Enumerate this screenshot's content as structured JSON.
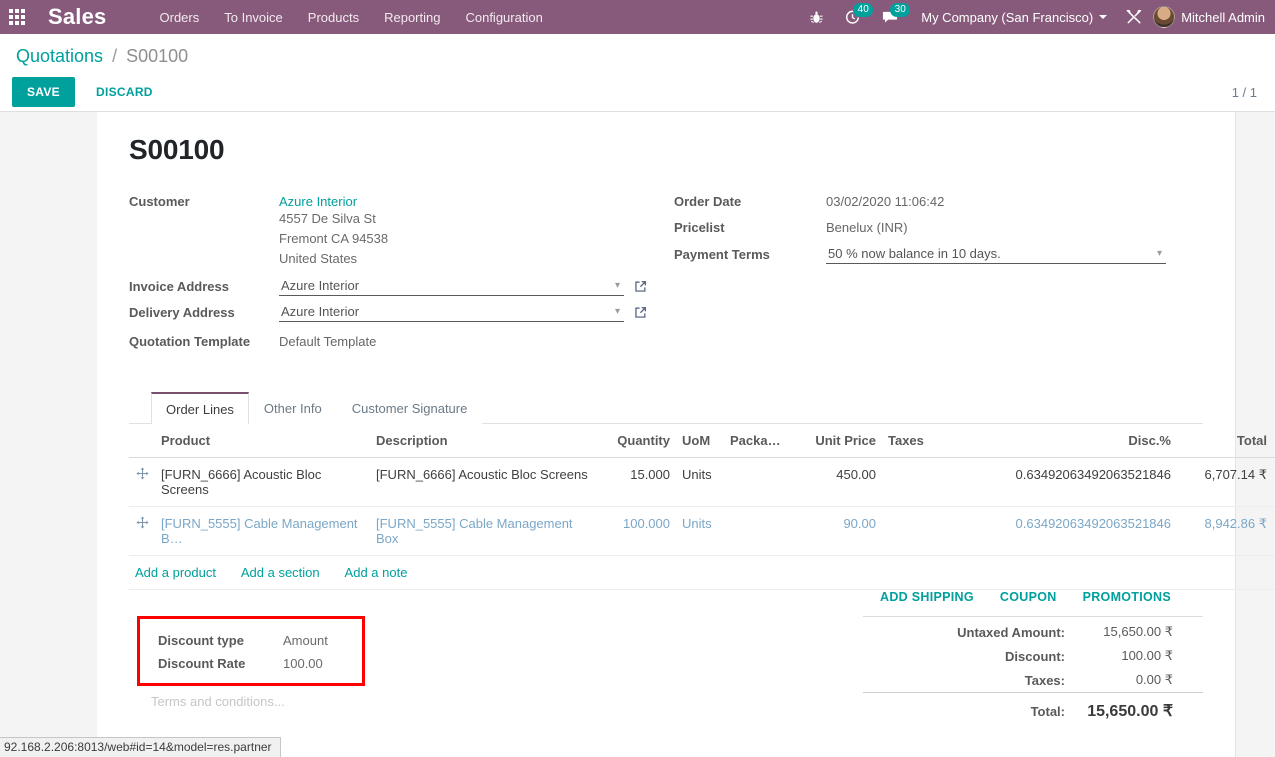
{
  "navbar": {
    "apps_icon": "apps-grid-icon",
    "brand": "Sales",
    "menu": [
      "Orders",
      "To Invoice",
      "Products",
      "Reporting",
      "Configuration"
    ],
    "bug_icon": "bug-icon",
    "activity_icon": "clock-activity-icon",
    "activity_count": "40",
    "messages_icon": "chat-bubble-icon",
    "messages_count": "30",
    "company": "My Company (San Francisco)",
    "tools_icon": "wrench-tools-icon",
    "user_name": "Mitchell Admin",
    "accent_color": "#875A7B",
    "badge_color": "#00A09D"
  },
  "control_panel": {
    "breadcrumb_root": "Quotations",
    "breadcrumb_sep": "/",
    "breadcrumb_current": "S00100",
    "save_label": "SAVE",
    "discard_label": "DISCARD",
    "pager": "1 / 1"
  },
  "form": {
    "record_title": "S00100",
    "left": {
      "customer_label": "Customer",
      "customer_name": "Azure Interior",
      "customer_address": [
        "4557 De Silva St",
        "Fremont CA 94538",
        "United States"
      ],
      "invoice_address_label": "Invoice Address",
      "invoice_address_value": "Azure Interior",
      "delivery_address_label": "Delivery Address",
      "delivery_address_value": "Azure Interior",
      "quotation_template_label": "Quotation Template",
      "quotation_template_value": "Default Template"
    },
    "right": {
      "order_date_label": "Order Date",
      "order_date_value": "03/02/2020 11:06:42",
      "pricelist_label": "Pricelist",
      "pricelist_value": "Benelux (INR)",
      "payment_terms_label": "Payment Terms",
      "payment_terms_value": "50 % now balance in 10 days."
    }
  },
  "notebook": {
    "tabs": [
      {
        "label": "Order Lines",
        "active": true
      },
      {
        "label": "Other Info",
        "active": false
      },
      {
        "label": "Customer Signature",
        "active": false
      }
    ]
  },
  "order_lines": {
    "columns": {
      "product": "Product",
      "description": "Description",
      "quantity": "Quantity",
      "uom": "UoM",
      "packaging": "Packa…",
      "unit_price": "Unit Price",
      "taxes": "Taxes",
      "discount": "Disc.%",
      "total": "Total"
    },
    "options_icon": "column-options-icon",
    "rows": [
      {
        "handle_icon": "drag-handle-icon",
        "product": "[FURN_6666] Acoustic Bloc Screens",
        "description": "[FURN_6666] Acoustic Bloc Screens",
        "quantity": "15.000",
        "uom": "Units",
        "packaging": "",
        "unit_price": "450.00",
        "taxes": "",
        "discount": "0.63492063492063521846",
        "total": "6,707.14 ₹",
        "delete_icon": "trash-icon",
        "selected": false
      },
      {
        "handle_icon": "drag-handle-icon",
        "product": "[FURN_5555] Cable Management B…",
        "description": "[FURN_5555] Cable Management Box",
        "quantity": "100.000",
        "uom": "Units",
        "packaging": "",
        "unit_price": "90.00",
        "taxes": "",
        "discount": "0.63492063492063521846",
        "total": "8,942.86 ₹",
        "delete_icon": "trash-icon",
        "selected": true
      }
    ],
    "add_links": [
      "Add a product",
      "Add a section",
      "Add a note"
    ]
  },
  "promotions": {
    "add_shipping": "ADD SHIPPING",
    "coupon": "COUPON",
    "promotions": "PROMOTIONS"
  },
  "discount_box": {
    "highlight_color": "#ff0000",
    "type_label": "Discount type",
    "type_value": "Amount",
    "rate_label": "Discount Rate",
    "rate_value": "100.00"
  },
  "terms": "Terms and conditions...",
  "totals": {
    "untaxed_label": "Untaxed Amount:",
    "untaxed_value": "15,650.00 ₹",
    "discount_label": "Discount:",
    "discount_value": "100.00 ₹",
    "taxes_label": "Taxes:",
    "taxes_value": "0.00 ₹",
    "total_label": "Total:",
    "total_value": "15,650.00 ₹"
  },
  "status_bar": {
    "url": "92.168.2.206:8013/web#id=14&model=res.partner"
  }
}
